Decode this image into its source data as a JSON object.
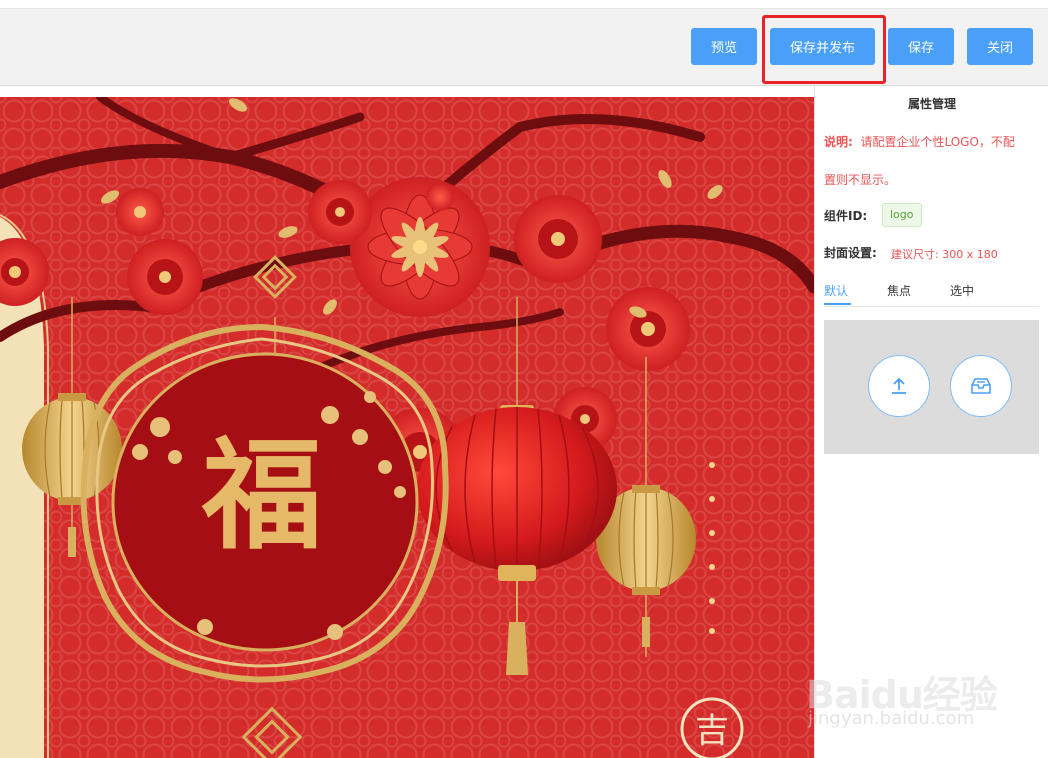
{
  "toolbar": {
    "preview_label": "预览",
    "save_publish_label": "保存并发布",
    "save_label": "保存",
    "close_label": "关闭"
  },
  "canvas": {
    "fu_character": "福",
    "ji_character": "吉"
  },
  "panel": {
    "title": "属性管理",
    "desc_label": "说明:",
    "desc_line1": "请配置企业个性LOGO，不配",
    "desc_line2": "置则不显示。",
    "component_id_label": "组件ID:",
    "component_id_value": "logo",
    "cover_label": "封面设置:",
    "cover_hint": "建议尺寸: 300 x 180",
    "tabs": [
      {
        "label": "默认",
        "active": true
      },
      {
        "label": "焦点",
        "active": false
      },
      {
        "label": "选中",
        "active": false
      }
    ],
    "upload_icon": "upload-icon",
    "library_icon": "image-library-icon"
  },
  "watermark": {
    "brand": "Baidu经验",
    "url": "jingyan.baidu.com"
  },
  "colors": {
    "button_blue": "#4aa0f7",
    "highlight_red": "#e8242a",
    "hint_red": "#e95454",
    "canvas_red": "#d42c2a",
    "gold": "#d8b05e"
  }
}
